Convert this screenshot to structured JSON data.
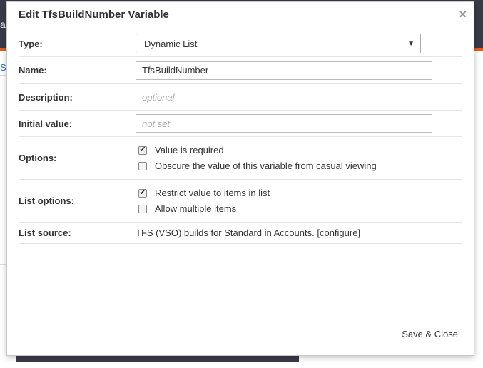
{
  "background": {
    "header_fragment": "a",
    "link_fragment": "S"
  },
  "modal": {
    "title": "Edit TfsBuildNumber Variable",
    "close_glyph": "×",
    "fields": {
      "type": {
        "label": "Type:",
        "selected": "Dynamic List"
      },
      "name": {
        "label": "Name:",
        "value": "TfsBuildNumber"
      },
      "description": {
        "label": "Description:",
        "placeholder": "optional"
      },
      "initial_value": {
        "label": "Initial value:",
        "placeholder": "not set"
      },
      "options": {
        "label": "Options:",
        "checkboxes": [
          {
            "label": "Value is required",
            "checked": true
          },
          {
            "label": "Obscure the value of this variable from casual viewing",
            "checked": false
          }
        ]
      },
      "list_options": {
        "label": "List options:",
        "checkboxes": [
          {
            "label": "Restrict value to items in list",
            "checked": true
          },
          {
            "label": "Allow multiple items",
            "checked": false
          }
        ]
      },
      "list_source": {
        "label": "List source:",
        "text": "TFS (VSO) builds for Standard in Accounts.",
        "link": "[configure]"
      }
    },
    "footer": {
      "save_close_label": "Save & Close"
    }
  },
  "colors": {
    "topbar": "#3b3a48",
    "accent": "#e85a1a",
    "link": "#2a6ebb"
  },
  "icons": {
    "close": "close-icon",
    "dropdown": "chevron-down-icon",
    "check": "check-icon"
  }
}
